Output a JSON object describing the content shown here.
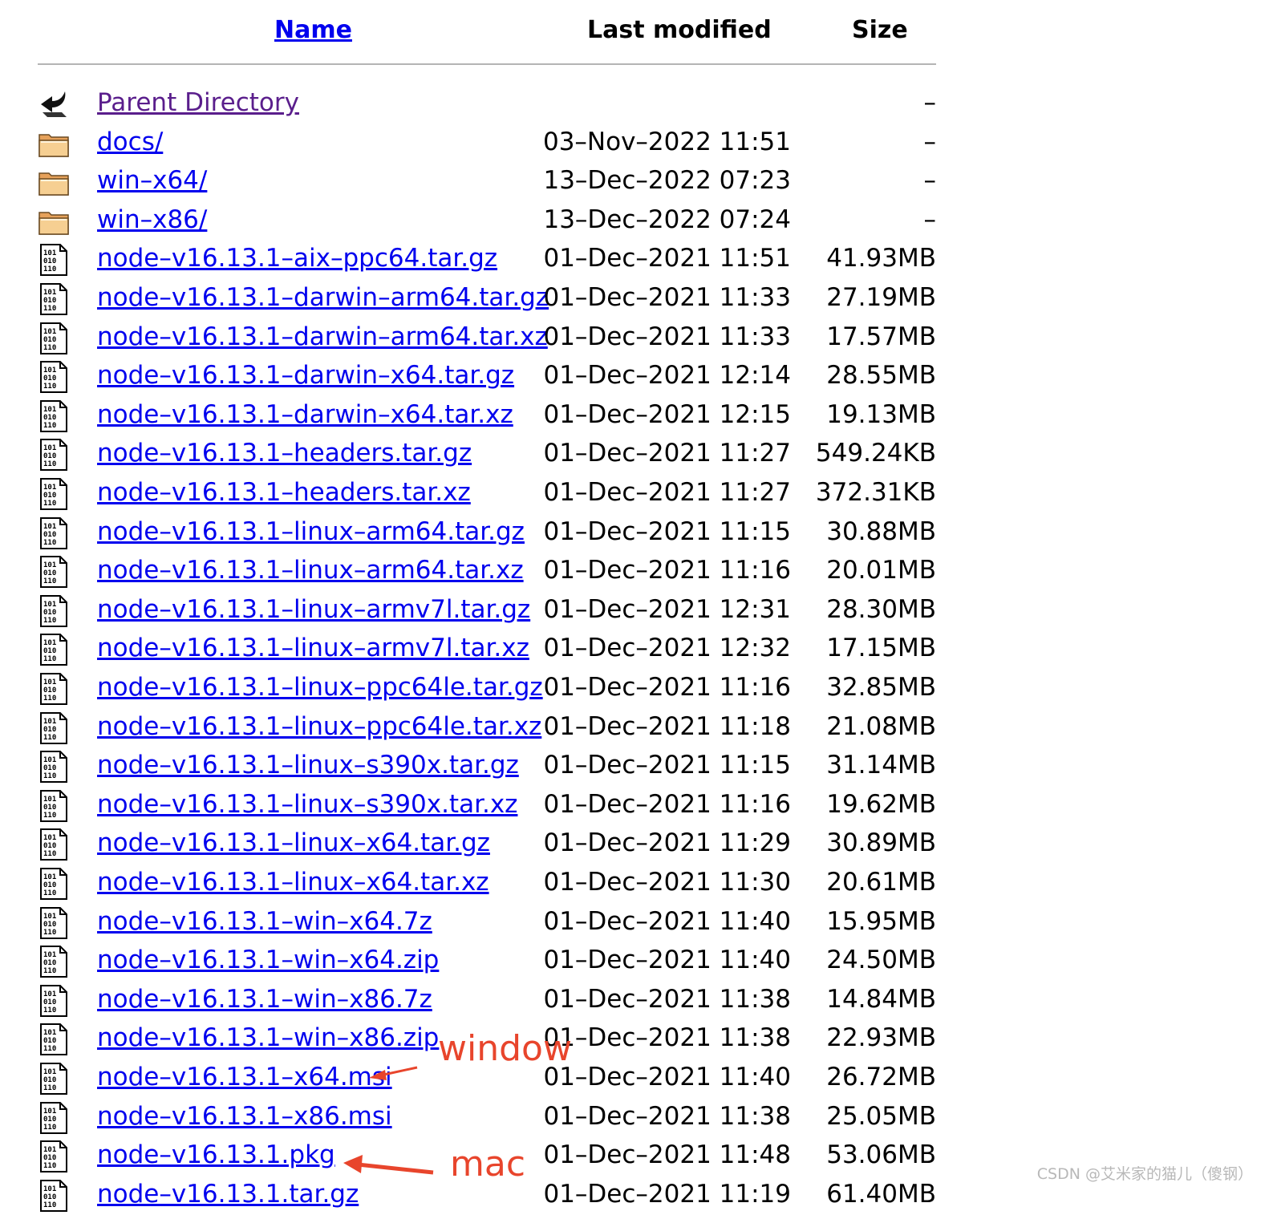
{
  "header": {
    "name": "Name",
    "last_modified": "Last modified",
    "size": "Size"
  },
  "rows": [
    {
      "icon": "back-icon",
      "name": "Parent Directory",
      "modified": "",
      "size": "–",
      "visited": true
    },
    {
      "icon": "folder-icon",
      "name": "docs/",
      "modified": "03–Nov–2022 11:51",
      "size": "–"
    },
    {
      "icon": "folder-icon",
      "name": "win–x64/",
      "modified": "13–Dec–2022 07:23",
      "size": "–"
    },
    {
      "icon": "folder-icon",
      "name": "win–x86/",
      "modified": "13–Dec–2022 07:24",
      "size": "–"
    },
    {
      "icon": "binary-file-icon",
      "name": "node–v16.13.1–aix–ppc64.tar.gz",
      "modified": "01–Dec–2021 11:51",
      "size": "41.93MB"
    },
    {
      "icon": "binary-file-icon",
      "name": "node–v16.13.1–darwin–arm64.tar.gz",
      "modified": "01–Dec–2021 11:33",
      "size": "27.19MB"
    },
    {
      "icon": "binary-file-icon",
      "name": "node–v16.13.1–darwin–arm64.tar.xz",
      "modified": "01–Dec–2021 11:33",
      "size": "17.57MB"
    },
    {
      "icon": "binary-file-icon",
      "name": "node–v16.13.1–darwin–x64.tar.gz",
      "modified": "01–Dec–2021 12:14",
      "size": "28.55MB"
    },
    {
      "icon": "binary-file-icon",
      "name": "node–v16.13.1–darwin–x64.tar.xz",
      "modified": "01–Dec–2021 12:15",
      "size": "19.13MB"
    },
    {
      "icon": "binary-file-icon",
      "name": "node–v16.13.1–headers.tar.gz",
      "modified": "01–Dec–2021 11:27",
      "size": "549.24KB"
    },
    {
      "icon": "binary-file-icon",
      "name": "node–v16.13.1–headers.tar.xz",
      "modified": "01–Dec–2021 11:27",
      "size": "372.31KB"
    },
    {
      "icon": "binary-file-icon",
      "name": "node–v16.13.1–linux–arm64.tar.gz",
      "modified": "01–Dec–2021 11:15",
      "size": "30.88MB"
    },
    {
      "icon": "binary-file-icon",
      "name": "node–v16.13.1–linux–arm64.tar.xz",
      "modified": "01–Dec–2021 11:16",
      "size": "20.01MB"
    },
    {
      "icon": "binary-file-icon",
      "name": "node–v16.13.1–linux–armv7l.tar.gz",
      "modified": "01–Dec–2021 12:31",
      "size": "28.30MB"
    },
    {
      "icon": "binary-file-icon",
      "name": "node–v16.13.1–linux–armv7l.tar.xz",
      "modified": "01–Dec–2021 12:32",
      "size": "17.15MB"
    },
    {
      "icon": "binary-file-icon",
      "name": "node–v16.13.1–linux–ppc64le.tar.gz",
      "modified": "01–Dec–2021 11:16",
      "size": "32.85MB"
    },
    {
      "icon": "binary-file-icon",
      "name": "node–v16.13.1–linux–ppc64le.tar.xz",
      "modified": "01–Dec–2021 11:18",
      "size": "21.08MB"
    },
    {
      "icon": "binary-file-icon",
      "name": "node–v16.13.1–linux–s390x.tar.gz",
      "modified": "01–Dec–2021 11:15",
      "size": "31.14MB"
    },
    {
      "icon": "binary-file-icon",
      "name": "node–v16.13.1–linux–s390x.tar.xz",
      "modified": "01–Dec–2021 11:16",
      "size": "19.62MB"
    },
    {
      "icon": "binary-file-icon",
      "name": "node–v16.13.1–linux–x64.tar.gz",
      "modified": "01–Dec–2021 11:29",
      "size": "30.89MB"
    },
    {
      "icon": "binary-file-icon",
      "name": "node–v16.13.1–linux–x64.tar.xz",
      "modified": "01–Dec–2021 11:30",
      "size": "20.61MB"
    },
    {
      "icon": "binary-file-icon",
      "name": "node–v16.13.1–win–x64.7z",
      "modified": "01–Dec–2021 11:40",
      "size": "15.95MB"
    },
    {
      "icon": "binary-file-icon",
      "name": "node–v16.13.1–win–x64.zip",
      "modified": "01–Dec–2021 11:40",
      "size": "24.50MB"
    },
    {
      "icon": "binary-file-icon",
      "name": "node–v16.13.1–win–x86.7z",
      "modified": "01–Dec–2021 11:38",
      "size": "14.84MB"
    },
    {
      "icon": "binary-file-icon",
      "name": "node–v16.13.1–win–x86.zip",
      "modified": "01–Dec–2021 11:38",
      "size": "22.93MB"
    },
    {
      "icon": "binary-file-icon",
      "name": "node–v16.13.1–x64.msi",
      "modified": "01–Dec–2021 11:40",
      "size": "26.72MB"
    },
    {
      "icon": "binary-file-icon",
      "name": "node–v16.13.1–x86.msi",
      "modified": "01–Dec–2021 11:38",
      "size": "25.05MB"
    },
    {
      "icon": "binary-file-icon",
      "name": "node–v16.13.1.pkg",
      "modified": "01–Dec–2021 11:48",
      "size": "53.06MB"
    },
    {
      "icon": "binary-file-icon",
      "name": "node–v16.13.1.tar.gz",
      "modified": "01–Dec–2021 11:19",
      "size": "61.40MB"
    }
  ],
  "annotations": {
    "window": "window",
    "mac": "mac",
    "color": "#e8452c"
  },
  "colors": {
    "link": "#0000ee",
    "visited": "#5a1e8c",
    "rule": "#b4b4b4"
  },
  "watermark": "CSDN @艾米家的猫儿（傻钢）"
}
